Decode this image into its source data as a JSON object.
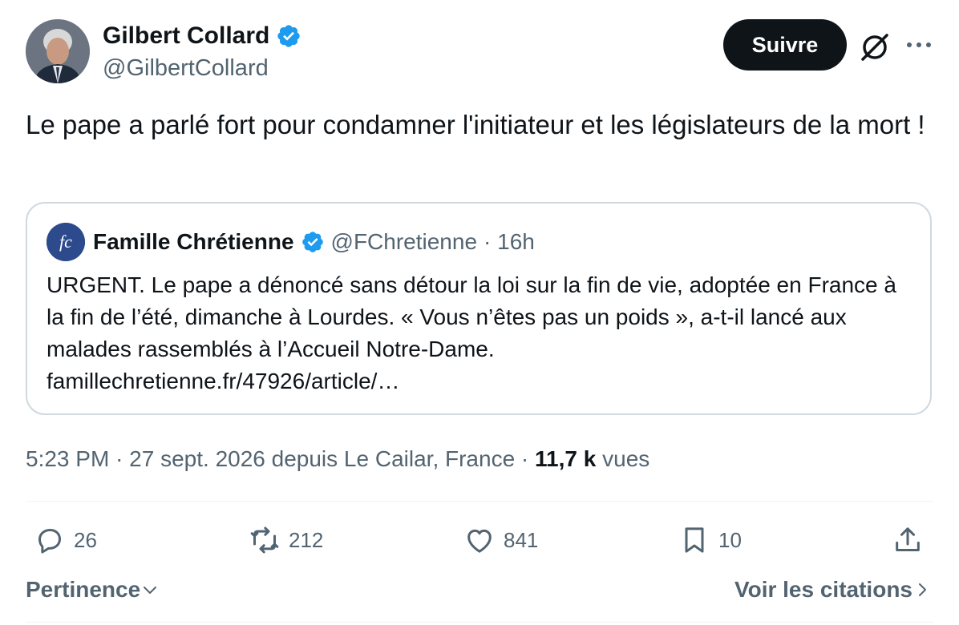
{
  "author": {
    "name": "Gilbert Collard",
    "handle": "@GilbertCollard"
  },
  "follow_button": "Suivre",
  "tweet_text": "Le pape a parlé fort pour condamner l'initiateur et les législateurs de la mort !",
  "quoted": {
    "name": "Famille Chrétienne",
    "handle": "@FChretienne",
    "time": "· 16h",
    "text": "URGENT. Le pape a dénoncé sans détour la loi sur la fin de vie, adoptée en France à la fin de l’été, dimanche à Lourdes. « Vous n’êtes pas un poids », a-t-il lancé aux malades rassemblés à l’Accueil Notre-Dame.",
    "link": "famillechretienne.fr/47926/article/…"
  },
  "meta": {
    "time": "5:23 PM",
    "date_location": "· 27 sept. 2026 depuis Le Cailar, France ·",
    "views_count": "11,7 k",
    "views_label": "vues"
  },
  "actions": {
    "replies": "26",
    "reposts": "212",
    "likes": "841",
    "bookmarks": "10"
  },
  "footer": {
    "sort_label": "Pertinence",
    "quotes_label": "Voir les citations"
  },
  "colors": {
    "verified": "#1d9bf0",
    "text_primary": "#0f1419",
    "text_secondary": "#536471",
    "border": "#cfd9de"
  },
  "icons": {
    "verified": "verified-badge-icon",
    "grok": "grok-icon",
    "more": "more-icon",
    "reply": "reply-icon",
    "repost": "repost-icon",
    "like": "heart-icon",
    "bookmark": "bookmark-icon",
    "share": "share-icon",
    "chevron_down": "chevron-down-icon",
    "chevron_right": "chevron-right-icon"
  }
}
